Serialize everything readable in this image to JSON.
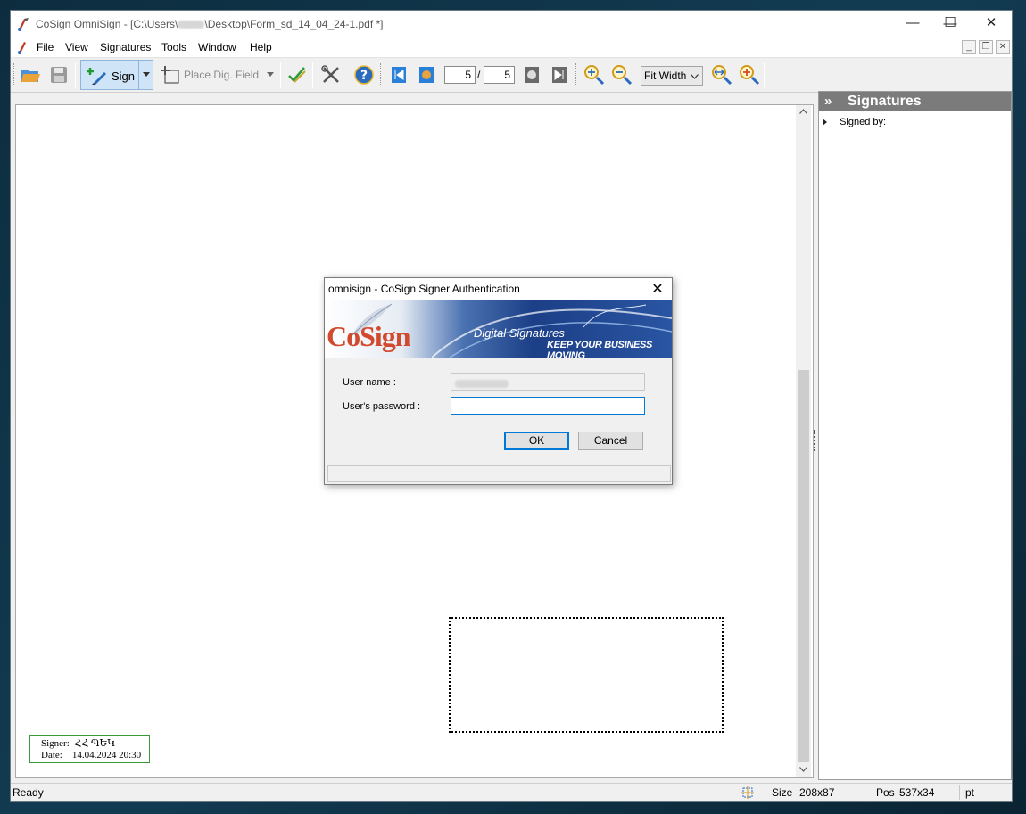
{
  "window": {
    "title_prefix": "CoSign OmniSign - [C:\\Users\\",
    "title_suffix": "\\Desktop\\Form_sd_14_04_24-1.pdf *]",
    "minimize": "—",
    "maximize": "☐",
    "close": "✕"
  },
  "menu": {
    "items": [
      "File",
      "View",
      "Signatures",
      "Tools",
      "Window",
      "Help"
    ],
    "mdi_min": "_",
    "mdi_restore": "❐",
    "mdi_close": "✕"
  },
  "toolbar": {
    "sign_label": "Sign",
    "place_field_label": "Place Dig. Field",
    "current_page": "5",
    "page_separator": "/",
    "total_pages": "5",
    "zoom_mode": "Fit Width"
  },
  "document": {
    "stamp_signer_label": "Signer:",
    "stamp_signer_value": "ՀՀ ՊԵԿ",
    "stamp_date_label": "Date:",
    "stamp_date_value": "14.04.2024 20:30"
  },
  "panel": {
    "title": "Signatures",
    "chevron": "»",
    "signed_by_label": "Signed by:"
  },
  "status": {
    "text": "Ready",
    "size_label": "Size",
    "size_value": "208x87",
    "pos_label": "Pos",
    "pos_value": "537x34",
    "unit": "pt"
  },
  "dialog": {
    "title": "omnisign - CoSign Signer Authentication",
    "close": "✕",
    "banner_brand": "CoSign",
    "banner_tagline1": "Digital Signatures",
    "banner_tagline2": "KEEP YOUR BUSINESS MOVING",
    "username_label": "User name :",
    "password_label": "User's password :",
    "ok_label": "OK",
    "cancel_label": "Cancel"
  },
  "colors": {
    "accent": "#0078d7",
    "sign_button_bg": "#cfe4f7",
    "panel_header": "#7b7b7b",
    "stamp_border": "#3a9a3a",
    "brand_red": "#d24a2e",
    "banner_blue": "#1c3f87"
  }
}
